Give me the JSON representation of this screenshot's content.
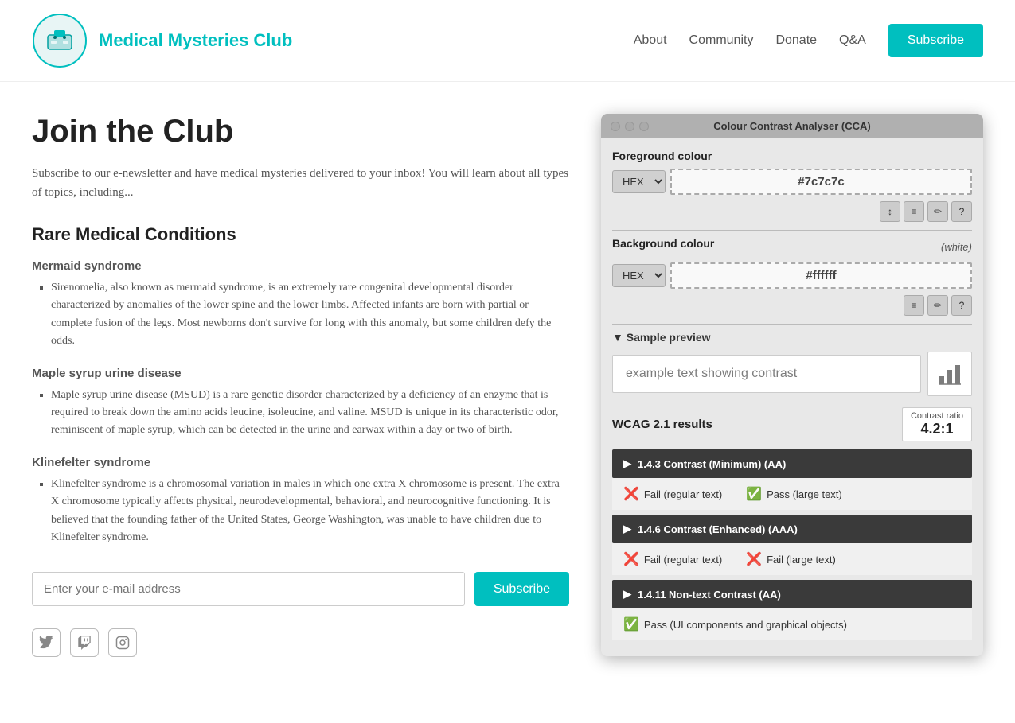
{
  "header": {
    "site_title": "Medical Mysteries Club",
    "nav": {
      "about": "About",
      "community": "Community",
      "donate": "Donate",
      "qa": "Q&A",
      "subscribe": "Subscribe"
    }
  },
  "page": {
    "heading": "Join the Club",
    "intro": "Subscribe to our e-newsletter and have medical mysteries delivered to your inbox! You will learn about all types of topics, including...",
    "section_heading": "Rare Medical Conditions",
    "conditions": [
      {
        "title": "Mermaid syndrome",
        "content": "Sirenomelia, also known as mermaid syndrome, is an extremely rare congenital developmental disorder characterized by anomalies of the lower spine and the lower limbs. Affected infants are born with partial or complete fusion of the legs. Most newborns don't survive for long with this anomaly, but some children defy the odds."
      },
      {
        "title": "Maple syrup urine disease",
        "content": "Maple syrup urine disease (MSUD) is a rare genetic disorder characterized by a deficiency of an enzyme that is required to break down the amino acids leucine, isoleucine, and valine. MSUD is unique in its characteristic odor, reminiscent of maple syrup, which can be detected in the urine and earwax within a day or two of birth."
      },
      {
        "title": "Klinefelter syndrome",
        "content": "Klinefelter syndrome is a chromosomal variation in males in which one extra X chromosome is present. The extra X chromosome typically affects physical, neurodevelopmental, behavioral, and neurocognitive functioning. It is believed that the founding father of the United States, George Washington, was unable to have children due to Klinefelter syndrome."
      }
    ],
    "email_placeholder": "Enter your e-mail address",
    "subscribe_btn": "Subscribe"
  },
  "cca": {
    "title": "Colour Contrast Analyser (CCA)",
    "foreground_label": "Foreground colour",
    "foreground_format": "HEX",
    "foreground_value": "#7c7c7c",
    "bg_label": "Background colour",
    "bg_white": "(white)",
    "bg_format": "HEX",
    "bg_value": "#ffffff",
    "sample_preview_heading": "▼ Sample preview",
    "sample_text": "example text showing contrast",
    "chart_icon": "📊",
    "wcag_label": "WCAG 2.1 results",
    "contrast_ratio_label": "Contrast ratio",
    "contrast_ratio_value": "4.2:1",
    "rules": [
      {
        "id": "1.4.3",
        "label": "1.4.3 Contrast (Minimum) (AA)",
        "results": [
          {
            "type": "fail",
            "text": "Fail (regular text)"
          },
          {
            "type": "pass",
            "text": "Pass (large text)"
          }
        ]
      },
      {
        "id": "1.4.6",
        "label": "1.4.6 Contrast (Enhanced) (AAA)",
        "results": [
          {
            "type": "fail",
            "text": "Fail (regular text)"
          },
          {
            "type": "fail",
            "text": "Fail (large text)"
          }
        ]
      },
      {
        "id": "1.4.11",
        "label": "1.4.11 Non-text Contrast (AA)",
        "results": [
          {
            "type": "pass",
            "text": "Pass (UI components and graphical objects)"
          }
        ]
      }
    ],
    "tool_icons": [
      "↕",
      "≡",
      "✏",
      "?"
    ]
  }
}
